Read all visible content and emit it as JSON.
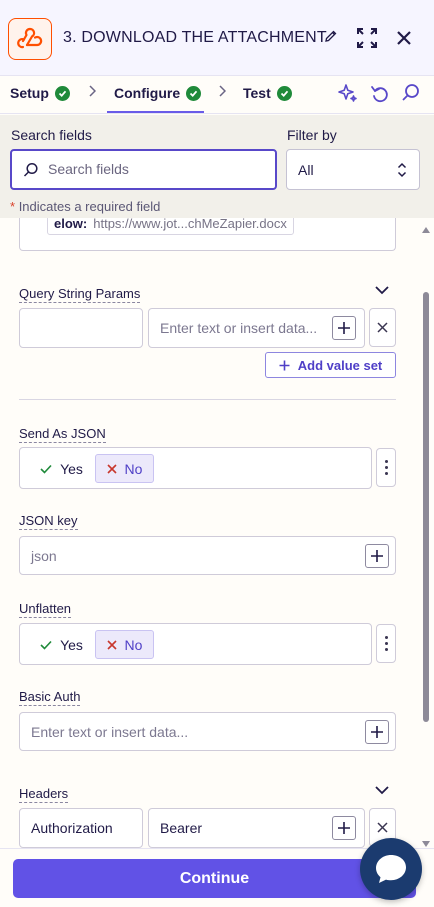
{
  "header": {
    "title": "3. DOWNLOAD THE ATTACHMENT",
    "app_icon": "webhook-icon",
    "accent": "#ff4f00"
  },
  "tabs": [
    {
      "label": "Setup",
      "complete": true
    },
    {
      "label": "Configure",
      "complete": true,
      "active": true
    },
    {
      "label": "Test",
      "complete": true
    }
  ],
  "search": {
    "label": "Search fields",
    "placeholder": "Search fields",
    "filter_label": "Filter by",
    "filter_value": "All",
    "required_note": "Indicates a required field",
    "required_star": "*"
  },
  "previous_field": {
    "chip_key": "elow:",
    "chip_value": "https://www.jot...chMeZapier.docx"
  },
  "query_params": {
    "label": "Query String Params",
    "value_placeholder": "Enter text or insert data...",
    "add_label": "Add value set"
  },
  "send_as_json": {
    "label": "Send As JSON",
    "yes": "Yes",
    "no": "No",
    "selected": "No"
  },
  "json_key": {
    "label": "JSON key",
    "placeholder": "json"
  },
  "unflatten": {
    "label": "Unflatten",
    "yes": "Yes",
    "no": "No",
    "selected": "No"
  },
  "basic_auth": {
    "label": "Basic Auth",
    "placeholder": "Enter text or insert data..."
  },
  "headers": {
    "label": "Headers",
    "key": "Authorization",
    "value": "Bearer"
  },
  "footer": {
    "continue_label": "Continue",
    "button_color": "#6152e6"
  }
}
